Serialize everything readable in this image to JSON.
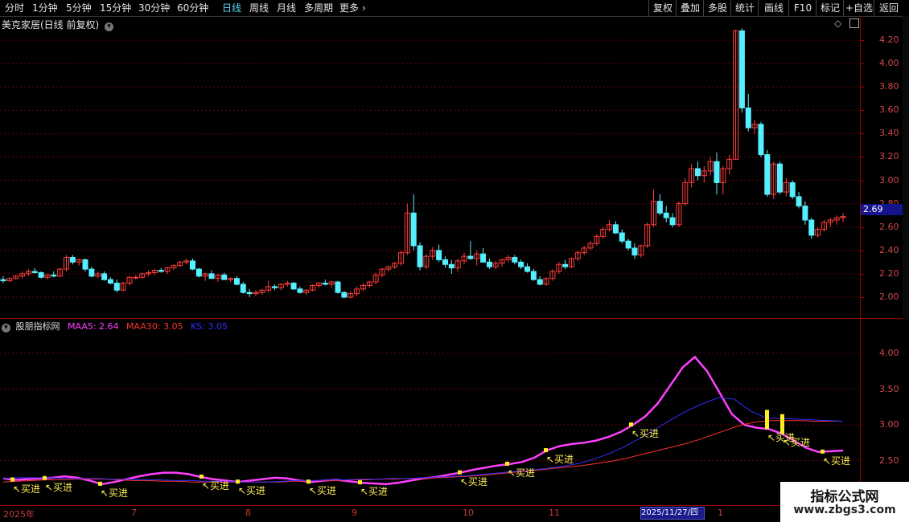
{
  "toolbar": {
    "tabs": [
      "分时",
      "1分钟",
      "5分钟",
      "15分钟",
      "30分钟",
      "60分钟",
      "日线",
      "周线",
      "月线",
      "多周期",
      "更多"
    ],
    "active": "日线",
    "right_buttons": [
      "复权",
      "叠加",
      "多股",
      "统计",
      "画线",
      "F10",
      "标记",
      "+自选",
      "返回"
    ]
  },
  "main_panel": {
    "title": "美克家居(日线 前复权)",
    "price_axis": [
      "4.20",
      "4.00",
      "3.80",
      "3.60",
      "3.40",
      "3.20",
      "3.00",
      "2.80",
      "2.60",
      "2.40",
      "2.20",
      "2.00"
    ],
    "current_price": "2.69"
  },
  "indicator_panel": {
    "name": "股朋指标网",
    "legend": [
      {
        "label": "MAA5: 2.64",
        "color": "#ff40ff"
      },
      {
        "label": "MAA30: 3.05",
        "color": "#ff3030"
      },
      {
        "label": "KS: 3.05",
        "color": "#3030ff"
      }
    ],
    "axis": [
      "4.00",
      "3.50",
      "3.00",
      "2.50"
    ],
    "buy_label": "买进"
  },
  "x_axis": {
    "labels": [
      "2025年",
      "7",
      "8",
      "9",
      "10",
      "11",
      "1"
    ],
    "cursor_date": "2025/11/27/四"
  },
  "watermark": {
    "line1": "指标公式网",
    "line2": "www.zbgs3.com"
  },
  "colors": {
    "up": "#ff3c3c",
    "down": "#54f0ff",
    "grid": "#a00000"
  },
  "chart_data": {
    "type": "candlestick",
    "ohlc": [
      [
        2.15,
        2.18,
        2.12,
        2.14
      ],
      [
        2.14,
        2.17,
        2.13,
        2.16
      ],
      [
        2.16,
        2.19,
        2.15,
        2.18
      ],
      [
        2.18,
        2.22,
        2.16,
        2.2
      ],
      [
        2.2,
        2.24,
        2.18,
        2.22
      ],
      [
        2.22,
        2.25,
        2.2,
        2.21
      ],
      [
        2.21,
        2.22,
        2.16,
        2.17
      ],
      [
        2.17,
        2.2,
        2.15,
        2.19
      ],
      [
        2.19,
        2.22,
        2.17,
        2.18
      ],
      [
        2.18,
        2.25,
        2.17,
        2.24
      ],
      [
        2.24,
        2.36,
        2.22,
        2.34
      ],
      [
        2.34,
        2.36,
        2.28,
        2.3
      ],
      [
        2.3,
        2.33,
        2.27,
        2.32
      ],
      [
        2.32,
        2.33,
        2.22,
        2.24
      ],
      [
        2.24,
        2.26,
        2.17,
        2.18
      ],
      [
        2.18,
        2.22,
        2.16,
        2.2
      ],
      [
        2.2,
        2.22,
        2.14,
        2.15
      ],
      [
        2.15,
        2.17,
        2.11,
        2.12
      ],
      [
        2.12,
        2.15,
        2.04,
        2.06
      ],
      [
        2.06,
        2.13,
        2.05,
        2.12
      ],
      [
        2.12,
        2.18,
        2.1,
        2.17
      ],
      [
        2.17,
        2.19,
        2.15,
        2.17
      ],
      [
        2.17,
        2.21,
        2.16,
        2.2
      ],
      [
        2.2,
        2.23,
        2.18,
        2.21
      ],
      [
        2.21,
        2.24,
        2.19,
        2.23
      ],
      [
        2.23,
        2.25,
        2.21,
        2.22
      ],
      [
        2.22,
        2.26,
        2.2,
        2.25
      ],
      [
        2.25,
        2.28,
        2.23,
        2.27
      ],
      [
        2.27,
        2.31,
        2.26,
        2.3
      ],
      [
        2.3,
        2.33,
        2.28,
        2.31
      ],
      [
        2.31,
        2.33,
        2.23,
        2.24
      ],
      [
        2.24,
        2.25,
        2.17,
        2.18
      ],
      [
        2.18,
        2.21,
        2.14,
        2.2
      ],
      [
        2.2,
        2.23,
        2.17,
        2.16
      ],
      [
        2.16,
        2.2,
        2.13,
        2.19
      ],
      [
        2.19,
        2.21,
        2.15,
        2.15
      ],
      [
        2.15,
        2.17,
        2.13,
        2.16
      ],
      [
        2.16,
        2.18,
        2.1,
        2.11
      ],
      [
        2.11,
        2.13,
        2.03,
        2.04
      ],
      [
        2.04,
        2.07,
        2.0,
        2.03
      ],
      [
        2.03,
        2.06,
        2.01,
        2.04
      ],
      [
        2.04,
        2.07,
        2.02,
        2.06
      ],
      [
        2.06,
        2.14,
        2.04,
        2.09
      ],
      [
        2.09,
        2.11,
        2.06,
        2.08
      ],
      [
        2.08,
        2.12,
        2.06,
        2.11
      ],
      [
        2.11,
        2.14,
        2.09,
        2.12
      ],
      [
        2.12,
        2.13,
        2.06,
        2.07
      ],
      [
        2.07,
        2.09,
        2.03,
        2.04
      ],
      [
        2.04,
        2.07,
        2.02,
        2.06
      ],
      [
        2.06,
        2.11,
        2.05,
        2.1
      ],
      [
        2.1,
        2.13,
        2.08,
        2.12
      ],
      [
        2.12,
        2.15,
        2.1,
        2.11
      ],
      [
        2.11,
        2.14,
        2.08,
        2.13
      ],
      [
        2.13,
        2.14,
        2.03,
        2.04
      ],
      [
        2.04,
        2.05,
        1.99,
        2.0
      ],
      [
        2.0,
        2.05,
        1.99,
        2.03
      ],
      [
        2.03,
        2.09,
        2.01,
        2.07
      ],
      [
        2.07,
        2.12,
        2.05,
        2.1
      ],
      [
        2.1,
        2.14,
        2.08,
        2.13
      ],
      [
        2.13,
        2.21,
        2.11,
        2.19
      ],
      [
        2.19,
        2.25,
        2.17,
        2.24
      ],
      [
        2.24,
        2.27,
        2.22,
        2.26
      ],
      [
        2.26,
        2.3,
        2.24,
        2.29
      ],
      [
        2.29,
        2.4,
        2.27,
        2.38
      ],
      [
        2.38,
        2.8,
        2.36,
        2.72
      ],
      [
        2.72,
        2.88,
        2.4,
        2.44
      ],
      [
        2.44,
        2.47,
        2.23,
        2.26
      ],
      [
        2.26,
        2.37,
        2.24,
        2.35
      ],
      [
        2.35,
        2.43,
        2.32,
        2.4
      ],
      [
        2.4,
        2.45,
        2.3,
        2.32
      ],
      [
        2.32,
        2.35,
        2.25,
        2.28
      ],
      [
        2.28,
        2.32,
        2.2,
        2.25
      ],
      [
        2.25,
        2.33,
        2.22,
        2.31
      ],
      [
        2.31,
        2.38,
        2.28,
        2.35
      ],
      [
        2.35,
        2.48,
        2.32,
        2.33
      ],
      [
        2.33,
        2.4,
        2.27,
        2.37
      ],
      [
        2.37,
        2.42,
        2.32,
        2.3
      ],
      [
        2.3,
        2.33,
        2.24,
        2.26
      ],
      [
        2.26,
        2.31,
        2.24,
        2.29
      ],
      [
        2.29,
        2.33,
        2.26,
        2.32
      ],
      [
        2.32,
        2.36,
        2.3,
        2.34
      ],
      [
        2.34,
        2.36,
        2.28,
        2.3
      ],
      [
        2.3,
        2.32,
        2.24,
        2.26
      ],
      [
        2.26,
        2.29,
        2.21,
        2.22
      ],
      [
        2.22,
        2.24,
        2.14,
        2.15
      ],
      [
        2.15,
        2.18,
        2.1,
        2.11
      ],
      [
        2.11,
        2.17,
        2.1,
        2.16
      ],
      [
        2.16,
        2.24,
        2.14,
        2.22
      ],
      [
        2.22,
        2.3,
        2.2,
        2.28
      ],
      [
        2.28,
        2.32,
        2.24,
        2.26
      ],
      [
        2.26,
        2.34,
        2.25,
        2.33
      ],
      [
        2.33,
        2.4,
        2.31,
        2.38
      ],
      [
        2.38,
        2.44,
        2.36,
        2.42
      ],
      [
        2.42,
        2.48,
        2.4,
        2.46
      ],
      [
        2.46,
        2.54,
        2.44,
        2.52
      ],
      [
        2.52,
        2.6,
        2.5,
        2.58
      ],
      [
        2.58,
        2.66,
        2.56,
        2.62
      ],
      [
        2.62,
        2.65,
        2.54,
        2.55
      ],
      [
        2.55,
        2.58,
        2.46,
        2.48
      ],
      [
        2.48,
        2.5,
        2.4,
        2.42
      ],
      [
        2.42,
        2.46,
        2.33,
        2.36
      ],
      [
        2.36,
        2.45,
        2.34,
        2.44
      ],
      [
        2.44,
        2.64,
        2.42,
        2.62
      ],
      [
        2.62,
        2.92,
        2.6,
        2.82
      ],
      [
        2.82,
        2.88,
        2.7,
        2.72
      ],
      [
        2.72,
        2.78,
        2.64,
        2.68
      ],
      [
        2.68,
        2.72,
        2.6,
        2.62
      ],
      [
        2.62,
        2.82,
        2.6,
        2.8
      ],
      [
        2.8,
        3.02,
        2.78,
        2.98
      ],
      [
        2.98,
        3.14,
        2.94,
        3.1
      ],
      [
        3.1,
        3.16,
        3.0,
        3.04
      ],
      [
        3.04,
        3.12,
        2.98,
        3.08
      ],
      [
        3.08,
        3.2,
        3.04,
        3.16
      ],
      [
        3.16,
        3.24,
        2.88,
        2.98
      ],
      [
        2.98,
        3.12,
        2.88,
        3.1
      ],
      [
        3.1,
        3.22,
        3.05,
        3.18
      ],
      [
        3.18,
        4.29,
        3.18,
        4.28
      ],
      [
        4.28,
        4.3,
        3.58,
        3.62
      ],
      [
        3.62,
        3.74,
        3.42,
        3.45
      ],
      [
        3.45,
        3.52,
        3.4,
        3.48
      ],
      [
        3.48,
        3.5,
        3.2,
        3.22
      ],
      [
        3.22,
        3.26,
        2.86,
        2.88
      ],
      [
        2.88,
        3.16,
        2.84,
        3.14
      ],
      [
        3.14,
        3.16,
        2.88,
        2.9
      ],
      [
        2.9,
        3.02,
        2.86,
        2.98
      ],
      [
        2.98,
        3.0,
        2.84,
        2.86
      ],
      [
        2.86,
        2.9,
        2.76,
        2.78
      ],
      [
        2.78,
        2.82,
        2.62,
        2.66
      ],
      [
        2.66,
        2.68,
        2.5,
        2.53
      ],
      [
        2.53,
        2.6,
        2.51,
        2.58
      ],
      [
        2.58,
        2.66,
        2.56,
        2.64
      ],
      [
        2.64,
        2.68,
        2.6,
        2.66
      ],
      [
        2.66,
        2.7,
        2.62,
        2.68
      ],
      [
        2.68,
        2.72,
        2.64,
        2.69
      ]
    ],
    "series": [
      {
        "name": "MAA5",
        "color": "#ff40ff",
        "values": [
          2.25,
          2.23,
          2.24,
          2.25,
          2.26,
          2.28,
          2.26,
          2.22,
          2.17,
          2.2,
          2.24,
          2.28,
          2.31,
          2.33,
          2.33,
          2.31,
          2.27,
          2.24,
          2.22,
          2.2,
          2.22,
          2.24,
          2.26,
          2.25,
          2.22,
          2.2,
          2.22,
          2.23,
          2.21,
          2.19,
          2.18,
          2.17,
          2.19,
          2.22,
          2.25,
          2.27,
          2.3,
          2.33,
          2.37,
          2.4,
          2.43,
          2.45,
          2.48,
          2.54,
          2.64,
          2.7,
          2.73,
          2.75,
          2.78,
          2.83,
          2.9,
          3.0,
          3.12,
          3.3,
          3.55,
          3.8,
          3.95,
          3.75,
          3.45,
          3.15,
          3.0,
          2.96,
          2.94,
          2.88,
          2.78,
          2.68,
          2.62,
          2.63,
          2.64
        ]
      },
      {
        "name": "MAA30",
        "color": "#ff3030",
        "values": [
          2.2,
          2.21,
          2.22,
          2.23,
          2.23,
          2.24,
          2.24,
          2.24,
          2.23,
          2.22,
          2.22,
          2.21,
          2.21,
          2.2,
          2.2,
          2.2,
          2.2,
          2.2,
          2.2,
          2.2,
          2.21,
          2.21,
          2.22,
          2.22,
          2.23,
          2.23,
          2.24,
          2.24,
          2.25,
          2.25,
          2.26,
          2.27,
          2.28,
          2.29,
          2.31,
          2.33,
          2.35,
          2.37,
          2.39,
          2.41,
          2.43,
          2.46,
          2.49,
          2.53,
          2.58,
          2.63,
          2.68,
          2.73,
          2.79,
          2.86,
          2.93,
          3.0,
          3.04,
          3.06,
          3.06,
          3.06,
          3.05,
          3.05,
          3.05
        ]
      },
      {
        "name": "KS",
        "color": "#3030ff",
        "values": [
          2.25,
          2.26,
          2.26,
          2.26,
          2.25,
          2.25,
          2.25,
          2.24,
          2.24,
          2.23,
          2.23,
          2.22,
          2.22,
          2.21,
          2.21,
          2.2,
          2.2,
          2.2,
          2.21,
          2.22,
          2.22,
          2.23,
          2.23,
          2.24,
          2.24,
          2.25,
          2.25,
          2.26,
          2.27,
          2.28,
          2.29,
          2.31,
          2.33,
          2.35,
          2.37,
          2.39,
          2.42,
          2.46,
          2.52,
          2.6,
          2.7,
          2.82,
          2.95,
          3.08,
          3.2,
          3.3,
          3.38,
          3.36,
          3.2,
          3.1,
          3.09,
          3.08,
          3.07,
          3.06,
          3.05
        ]
      }
    ]
  }
}
